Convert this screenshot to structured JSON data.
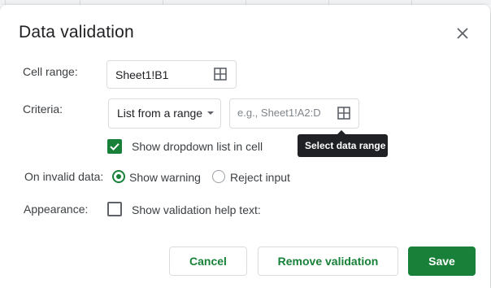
{
  "dialog": {
    "title": "Data validation"
  },
  "cell_range": {
    "label": "Cell range:",
    "value": "Sheet1!B1"
  },
  "criteria": {
    "label": "Criteria:",
    "type_selected": "List from a range",
    "range_placeholder": "e.g., Sheet1!A2:D",
    "tooltip": "Select data range",
    "show_dropdown_label": "Show dropdown list in cell",
    "show_dropdown_checked": true
  },
  "on_invalid": {
    "label": "On invalid data:",
    "options": [
      {
        "label": "Show warning",
        "selected": true
      },
      {
        "label": "Reject input",
        "selected": false
      }
    ]
  },
  "appearance": {
    "label": "Appearance:",
    "help_text_label": "Show validation help text:",
    "help_text_checked": false
  },
  "buttons": {
    "cancel": "Cancel",
    "remove": "Remove validation",
    "save": "Save"
  },
  "colors": {
    "accent": "#188038",
    "tooltip_bg": "#202124"
  },
  "icons": {
    "close": "close-icon",
    "range_picker": "grid-icon"
  }
}
